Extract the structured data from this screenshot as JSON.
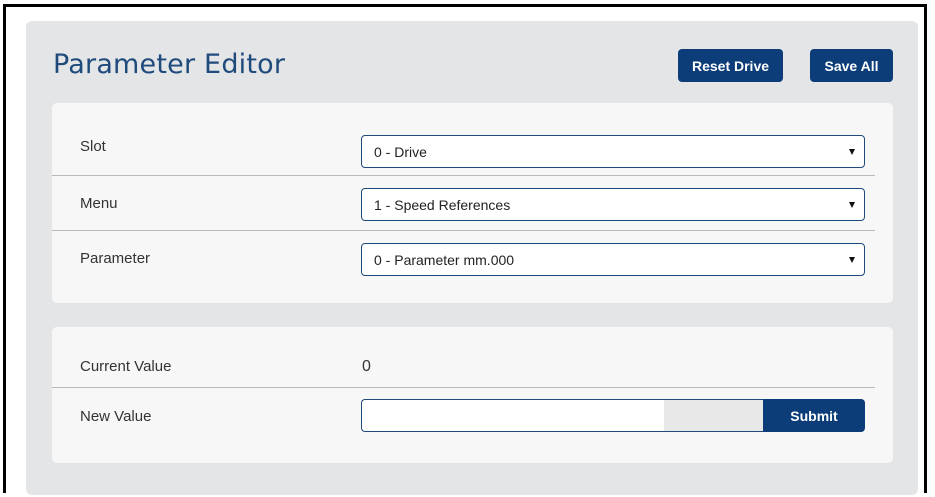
{
  "editor": {
    "title": "Parameter Editor",
    "reset_label": "Reset Drive",
    "save_label": "Save All"
  },
  "params": {
    "slot": {
      "label": "Slot",
      "selected": "0 - Drive"
    },
    "menu": {
      "label": "Menu",
      "selected": "1 - Speed References"
    },
    "parameter": {
      "label": "Parameter",
      "selected": "0 - Parameter mm.000"
    }
  },
  "value": {
    "current_label": "Current Value",
    "current_value": "0",
    "new_label": "New Value",
    "new_value": "",
    "submit_label": "Submit"
  },
  "colors": {
    "primary": "#0c3d78",
    "title": "#1f4a7c",
    "panel_bg": "#e4e5e7",
    "card_bg": "#f7f7f7"
  },
  "icons": {
    "select_caret": "caret-down-icon"
  }
}
